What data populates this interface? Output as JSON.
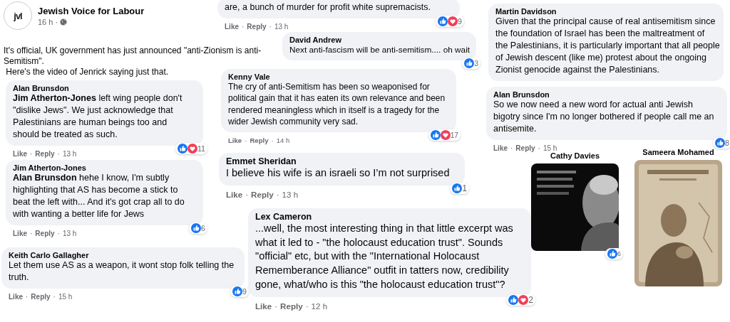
{
  "post": {
    "page_name": "Jewish Voice for Labour",
    "logo_text": "jvl",
    "time": "16 h ·",
    "paragraphs": [
      [
        "It's official, UK government has just announced \"anti-Zionism is anti-",
        "Semitism\"."
      ],
      [
        " Here's the video of Jenrick saying just that."
      ]
    ]
  },
  "separator": "·",
  "comments": [
    {
      "kind": "text",
      "author": "Alan Brunsdon",
      "lines": [
        "**Jim Atherton-Jones** left wing people don't",
        "\"dislike Jews\". We just acknowledge that",
        "Palestinians are human beings too and",
        "should be treated as such."
      ],
      "reactions": {
        "like": true,
        "love": true,
        "count": "11"
      },
      "meta": {
        "actions": [
          "Like",
          "Reply"
        ],
        "time": "13 h"
      }
    },
    {
      "kind": "text",
      "author": "Jim Atherton-Jones",
      "lines": [
        "**Alan Brunsdon** hehe I know, I'm subtly",
        "highlighting that AS has become a stick to",
        "beat the left with... And it's got crap all to do",
        "with wanting a better life for Jews"
      ],
      "reactions": {
        "like": true,
        "count": "6"
      },
      "meta": {
        "actions": [
          "Like",
          "Reply"
        ],
        "time": "13 h"
      }
    },
    {
      "kind": "text",
      "author": "Keith Carlo Gallagher",
      "lines": [
        "Let them use AS as a weapon, it wont stop folk telling the",
        "truth."
      ],
      "reactions": {
        "like": true,
        "count": "9"
      },
      "meta": {
        "actions": [
          "Like",
          "Reply"
        ],
        "time": "15 h"
      }
    },
    {
      "kind": "text",
      "lines": [
        "are, a bunch of murder for profit white supremacists."
      ],
      "reactions": {
        "like": true,
        "love": true,
        "count": "9"
      },
      "meta": {
        "actions": [
          "Like",
          "Reply"
        ],
        "time": "13 h"
      }
    },
    {
      "kind": "text",
      "author": "David Andrew",
      "lines": [
        "Next anti-fascism will be anti-semitism.... oh wait"
      ],
      "reactions": {
        "like": true,
        "count": "3"
      }
    },
    {
      "kind": "text",
      "author": "Kenny Vale",
      "lines": [
        "The cry of anti-Semitism has been so weaponised for",
        "political gain that it has eaten its own relevance and been",
        "rendered meaningless which in itself is a tragedy for the",
        "wider Jewish community very sad."
      ],
      "reactions": {
        "like": true,
        "love": true,
        "count": "17"
      },
      "meta": {
        "actions": [
          "Like",
          "Reply"
        ],
        "time": "14 h"
      }
    },
    {
      "kind": "text",
      "author": "Emmet Sheridan",
      "lines": [
        "I believe his wife is an israeli so I’m not surprised"
      ],
      "reactions": {
        "like": true,
        "count": "1"
      },
      "meta": {
        "actions": [
          "Like",
          "Reply"
        ],
        "time": "13 h"
      }
    },
    {
      "kind": "text",
      "author": "Lex Cameron",
      "lines": [
        "...well, the most interesting thing in that little excerpt was",
        "what it led to - \"the holocaust education trust\". Sounds",
        "\"official\" etc, but with the \"International Holocaust",
        "Rememberance Alliance\" outfit in tatters now, credibility",
        "gone, what/who is this \"the holocaust education trust\"?"
      ],
      "reactions": {
        "like": true,
        "love": true,
        "count": "2"
      },
      "meta": {
        "actions": [
          "Like",
          "Reply"
        ],
        "time": "12 h"
      }
    },
    {
      "kind": "text",
      "author": "Martin Davidson",
      "lines": [
        "Given that the principal cause of real antisemitism since",
        "the foundation of Israel has been the maltreatment of",
        "the Palestinians, it is particularly important that all people",
        "of Jewish descent (like me) protest about the ongoing",
        "Zionist genocide against the Palestinians."
      ]
    },
    {
      "kind": "text",
      "author": "Alan Brunsdon",
      "lines": [
        "So we now need a new word for actual anti Jewish",
        "bigotry since I'm no longer bothered if people call me an",
        "antisemite."
      ],
      "reactions": {
        "like": true,
        "count": "8"
      },
      "meta": {
        "actions": [
          "Like",
          "Reply"
        ],
        "time": "15 h"
      }
    },
    {
      "author": "Cathy Davies",
      "reactions": {
        "like": true,
        "count": "6"
      }
    },
    {
      "author": "Sameera Mohamed"
    }
  ]
}
